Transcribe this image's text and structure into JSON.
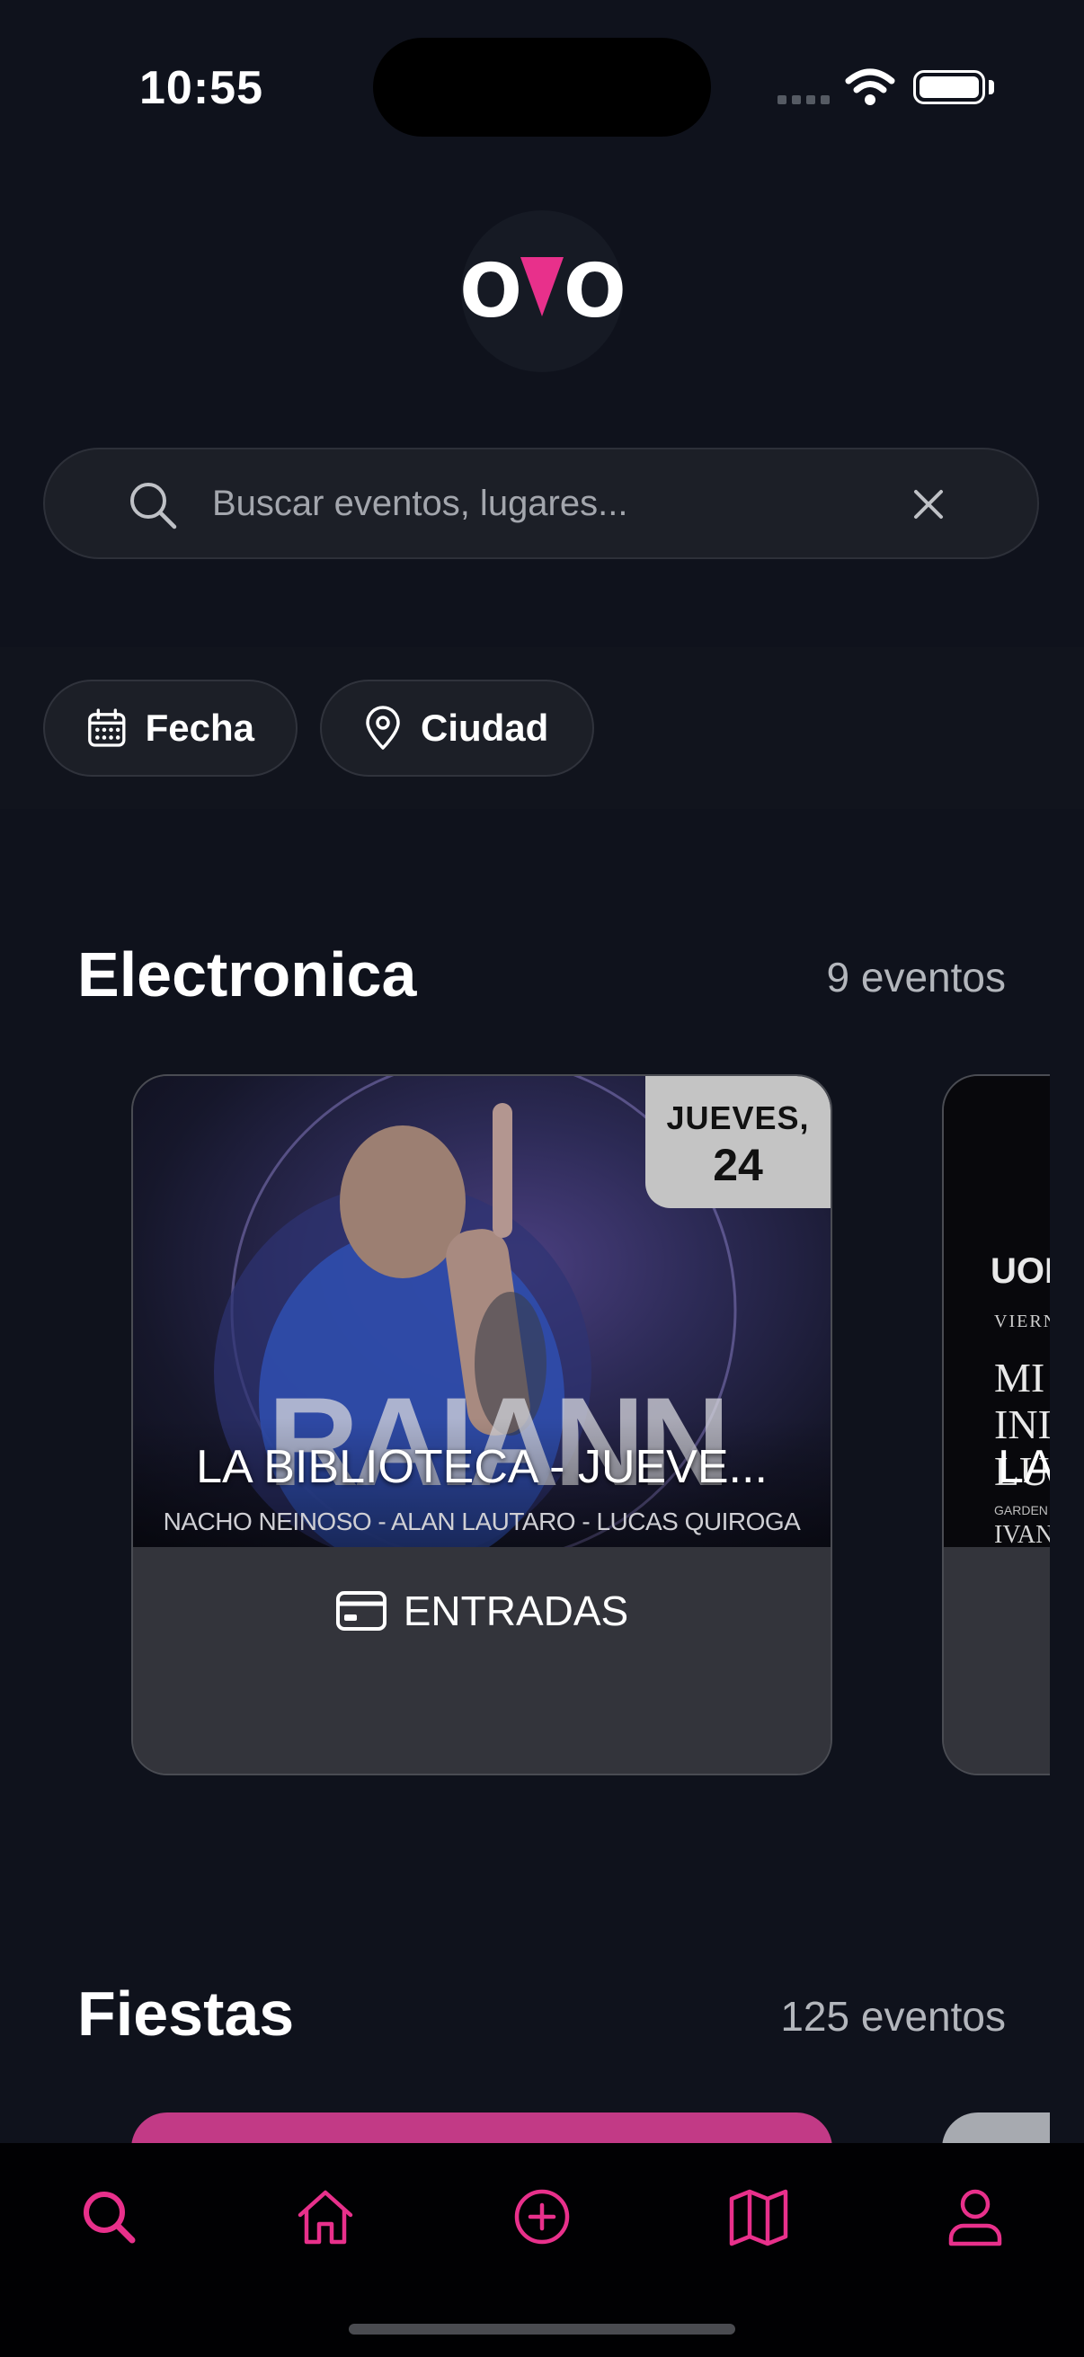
{
  "status_bar": {
    "time": "10:55"
  },
  "logo": {
    "left": "O",
    "middle": "A",
    "right": "O"
  },
  "search": {
    "placeholder": "Buscar eventos, lugares...",
    "value": ""
  },
  "filters": [
    {
      "label": "Fecha",
      "icon": "calendar-icon"
    },
    {
      "label": "Ciudad",
      "icon": "location-pin-icon"
    }
  ],
  "sections": [
    {
      "title": "Electronica",
      "count": "9 eventos",
      "events": [
        {
          "badge_day": "JUEVES,",
          "badge_date": "24",
          "poster_text": "RAIANN",
          "title": "LA BIBLIOTECA - JUEVE...",
          "subtitle": "NACHO NEINOSO - ALAN LAUTARO - LUCAS QUIROGA",
          "button": "ENTRADAS"
        },
        {
          "poster_lines": [
            "UOI",
            "VIERN",
            "MI",
            "INI",
            "LU",
            "GARDEN",
            "IVAN"
          ],
          "title": "LA"
        }
      ]
    },
    {
      "title": "Fiestas",
      "count": "125 eventos"
    }
  ],
  "tabbar": {
    "items": [
      "search-icon",
      "home-icon",
      "add-icon",
      "map-icon",
      "profile-icon"
    ],
    "active": "search-icon",
    "color": "#e8308b"
  },
  "colors": {
    "accent": "#e8308b",
    "background": "#0f121c"
  }
}
